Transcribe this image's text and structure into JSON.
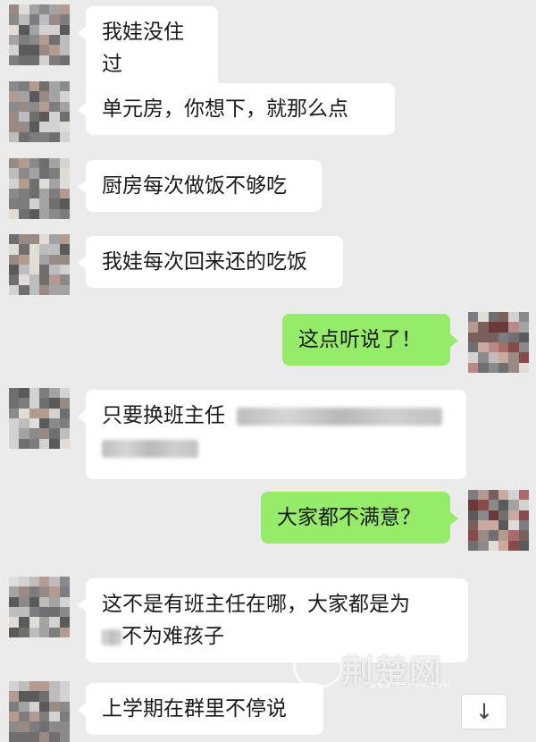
{
  "messages": [
    {
      "side": "left",
      "text": "我娃没住过"
    },
    {
      "side": "left",
      "text": "单元房，你想下，就那么点"
    },
    {
      "side": "left",
      "text": "厨房每次做饭不够吃"
    },
    {
      "side": "left",
      "text": "我娃每次回来还的吃饭"
    },
    {
      "side": "right",
      "text": "这点听说了！"
    },
    {
      "side": "left",
      "text": "只要换班主任"
    },
    {
      "side": "right",
      "text": "大家都不满意？"
    },
    {
      "side": "left",
      "line1": "这不是有班主任在哪，大家都是为",
      "line2": "不为难孩子"
    },
    {
      "side": "left",
      "text": "上学期在群里不停说"
    }
  ],
  "watermark": {
    "text": "荆楚网",
    "url": "www.cnhan.com"
  },
  "scroll_button": {
    "icon": "arrow-down-icon",
    "glyph": "↓"
  },
  "colors": {
    "background": "#ebebeb",
    "bubble_left": "#ffffff",
    "bubble_right": "#95ec69"
  }
}
